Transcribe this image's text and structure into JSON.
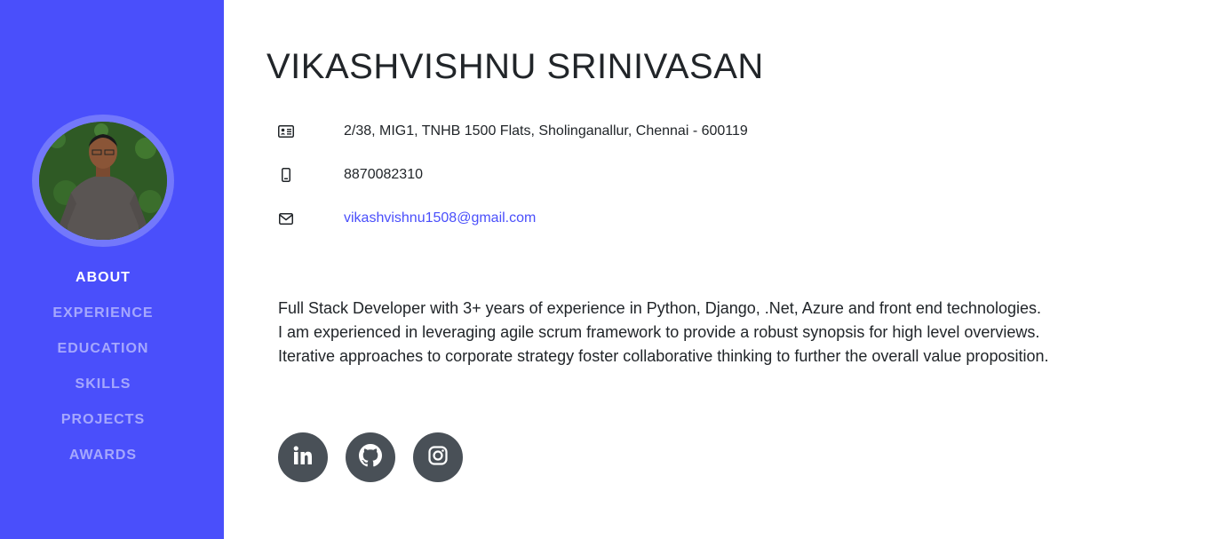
{
  "sidebar": {
    "nav": [
      {
        "label": "ABOUT",
        "active": true
      },
      {
        "label": "EXPERIENCE",
        "active": false
      },
      {
        "label": "EDUCATION",
        "active": false
      },
      {
        "label": "SKILLS",
        "active": false
      },
      {
        "label": "PROJECTS",
        "active": false
      },
      {
        "label": "AWARDS",
        "active": false
      }
    ]
  },
  "profile": {
    "name": "VIKASHVISHNU SRINIVASAN",
    "address": "2/38, MIG1, TNHB 1500 Flats, Sholinganallur, Chennai - 600119",
    "phone": "8870082310",
    "email": "vikashvishnu1508@gmail.com",
    "bio": [
      "Full Stack Developer with 3+ years of experience in Python, Django, .Net, Azure and front end technologies.",
      "I am experienced in leveraging agile scrum framework to provide a robust synopsis for high level overviews.",
      "Iterative approaches to corporate strategy foster collaborative thinking to further the overall value proposition."
    ]
  },
  "icons": {
    "address": "address-card-icon",
    "phone": "mobile-phone-icon",
    "email": "envelope-icon",
    "social": [
      "linkedin-icon",
      "github-icon",
      "instagram-icon"
    ]
  },
  "colors": {
    "sidebar": "#4a4ffb",
    "avatar_ring": "#7378fb",
    "link": "#4a4ffb",
    "social_bg": "#495057"
  }
}
